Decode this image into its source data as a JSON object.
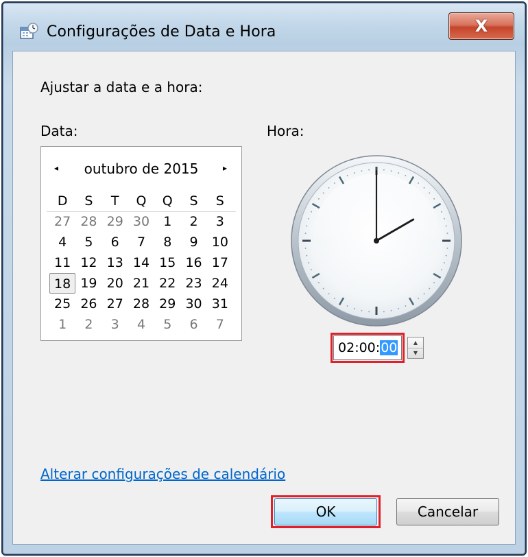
{
  "window": {
    "title": "Configurações de Data e Hora",
    "close_label": "X"
  },
  "labels": {
    "adjust": "Ajustar a data e a hora:",
    "date": "Data:",
    "time": "Hora:"
  },
  "calendar": {
    "month_title": "outubro de 2015",
    "prev_icon": "◂",
    "next_icon": "▸",
    "weekdays": [
      "D",
      "S",
      "T",
      "Q",
      "Q",
      "S",
      "S"
    ],
    "weeks": [
      [
        "27",
        "28",
        "29",
        "30",
        "1",
        "2",
        "3"
      ],
      [
        "4",
        "5",
        "6",
        "7",
        "8",
        "9",
        "10"
      ],
      [
        "11",
        "12",
        "13",
        "14",
        "15",
        "16",
        "17"
      ],
      [
        "18",
        "19",
        "20",
        "21",
        "22",
        "23",
        "24"
      ],
      [
        "25",
        "26",
        "27",
        "28",
        "29",
        "30",
        "31"
      ],
      [
        "1",
        "2",
        "3",
        "4",
        "5",
        "6",
        "7"
      ]
    ],
    "selected_day": "18"
  },
  "clock": {
    "hour": 2,
    "minute": 0,
    "second": 0
  },
  "time_field": {
    "hours": "02",
    "minutes": "00",
    "seconds": "00",
    "sep": ":"
  },
  "link": {
    "label": "Alterar configurações de calendário"
  },
  "buttons": {
    "ok": "OK",
    "cancel": "Cancelar"
  },
  "colors": {
    "highlight": "#e0202a",
    "link": "#0066cc",
    "selection": "#3399ff"
  }
}
